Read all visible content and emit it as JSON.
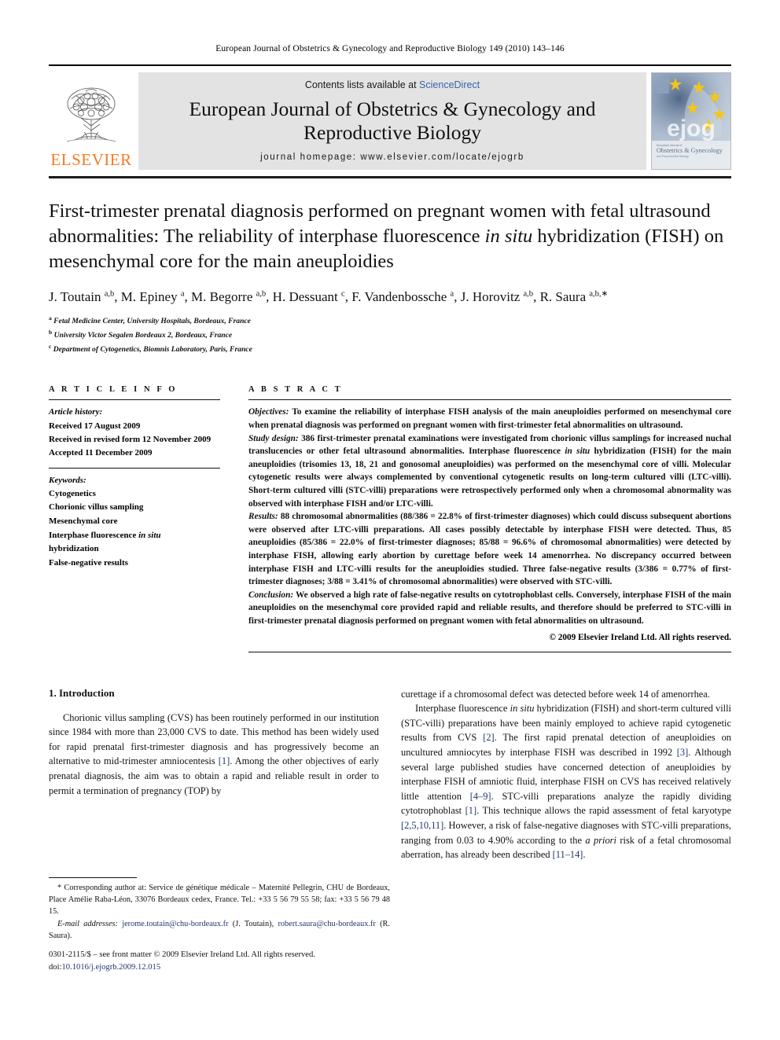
{
  "running_head": "European Journal of Obstetrics & Gynecology and Reproductive Biology 149 (2010) 143–146",
  "masthead": {
    "publisher": "ELSEVIER",
    "contents_prefix": "Contents lists available at ",
    "contents_link": "ScienceDirect",
    "journal_title_line1": "European Journal of Obstetrics & Gynecology and",
    "journal_title_line2": "Reproductive Biology",
    "homepage": "journal homepage: www.elsevier.com/locate/ejogrb",
    "cover_wordmark": "ejog",
    "cover_sub1": "Obstetrics & Gynecology",
    "cover_sub2": "and Reproductive Biology",
    "cover_kicker": "European Journal of"
  },
  "article": {
    "title": "First-trimester prenatal diagnosis performed on pregnant women with fetal ultrasound abnormalities: The reliability of interphase fluorescence in situ hybridization (FISH) on mesenchymal core for the main aneuploidies",
    "authors_html": "J. Toutain <sup>a,b</sup>, M. Epiney <sup>a</sup>, M. Begorre <sup>a,b</sup>, H. Dessuant <sup>c</sup>, F. Vandenbossche <sup>a</sup>, J. Horovitz <sup>a,b</sup>, R. Saura <sup>a,b,∗</sup>",
    "affiliations": [
      "Fetal Medicine Center, University Hospitals, Bordeaux, France",
      "University Victor Segalen Bordeaux 2, Bordeaux, France",
      "Department of Cytogenetics, Biomnis Laboratory, Paris, France"
    ],
    "affiliation_marks": [
      "a",
      "b",
      "c"
    ]
  },
  "info": {
    "heading": "A R T I C L E   I N F O",
    "history_label": "Article history:",
    "history": [
      "Received 17 August 2009",
      "Received in revised form 12 November 2009",
      "Accepted 11 December 2009"
    ],
    "keywords_label": "Keywords:",
    "keywords": [
      "Cytogenetics",
      "Chorionic villus sampling",
      "Mesenchymal core",
      "Interphase fluorescence in situ",
      "hybridization",
      "False-negative results"
    ]
  },
  "abstract": {
    "heading": "A B S T R A C T",
    "objectives_label": "Objectives:",
    "objectives_text": " To examine the reliability of interphase FISH analysis of the main aneuploidies performed on mesenchymal core when prenatal diagnosis was performed on pregnant women with first-trimester fetal abnormalities on ultrasound.",
    "study_design_label": "Study design:",
    "study_design_text": " 386 first-trimester prenatal examinations were investigated from chorionic villus samplings for increased nuchal translucencies or other fetal ultrasound abnormalities. Interphase fluorescence in situ hybridization (FISH) for the main aneuploidies (trisomies 13, 18, 21 and gonosomal aneuploidies) was performed on the mesenchymal core of villi. Molecular cytogenetic results were always complemented by conventional cytogenetic results on long-term cultured villi (LTC-villi). Short-term cultured villi (STC-villi) preparations were retrospectively performed only when a chromosomal abnormality was observed with interphase FISH and/or LTC-villi.",
    "results_label": "Results:",
    "results_text": " 88 chromosomal abnormalities (88/386 = 22.8% of first-trimester diagnoses) which could discuss subsequent abortions were observed after LTC-villi preparations. All cases possibly detectable by interphase FISH were detected. Thus, 85 aneuploidies (85/386 = 22.0% of first-trimester diagnoses; 85/88 = 96.6% of chromosomal abnormalities) were detected by interphase FISH, allowing early abortion by curettage before week 14 amenorrhea. No discrepancy occurred between interphase FISH and LTC-villi results for the aneuploidies studied. Three false-negative results (3/386 = 0.77% of first-trimester diagnoses; 3/88 = 3.41% of chromosomal abnormalities) were observed with STC-villi.",
    "conclusion_label": "Conclusion:",
    "conclusion_text": " We observed a high rate of false-negative results on cytotrophoblast cells. Conversely, interphase FISH of the main aneuploidies on the mesenchymal core provided rapid and reliable results, and therefore should be preferred to STC-villi in first-trimester prenatal diagnosis performed on pregnant women with fetal abnormalities on ultrasound.",
    "copyright": "© 2009 Elsevier Ireland Ltd. All rights reserved."
  },
  "introduction": {
    "heading": "1. Introduction",
    "left_para_1": "Chorionic villus sampling (CVS) has been routinely performed in our institution since 1984 with more than 23,000 CVS to date. This method has been widely used for rapid prenatal first-trimester diagnosis and has progressively become an alternative to mid-trimester amniocentesis [1]. Among the other objectives of early prenatal diagnosis, the aim was to obtain a rapid and reliable result in order to permit a termination of pregnancy (TOP) by",
    "right_para_1_cont": "curettage if a chromosomal defect was detected before week 14 of amenorrhea.",
    "right_para_2": "Interphase fluorescence in situ hybridization (FISH) and short-term cultured villi (STC-villi) preparations have been mainly employed to achieve rapid cytogenetic results from CVS [2]. The first rapid prenatal detection of aneuploidies on uncultured amniocytes by interphase FISH was described in 1992 [3]. Although several large published studies have concerned detection of aneuploidies by interphase FISH of amniotic fluid, interphase FISH on CVS has received relatively little attention [4–9]. STC-villi preparations analyze the rapidly dividing cytotrophoblast [1]. This technique allows the rapid assessment of fetal karyotype [2,5,10,11]. However, a risk of false-negative diagnoses with STC-villi preparations, ranging from 0.03 to 4.90% according to the a priori risk of a fetal chromosomal aberration, has already been described [11–14]."
  },
  "footnotes": {
    "corresponding_marker": "*",
    "corresponding_text": "Corresponding author at: Service de génétique médicale – Maternité Pellegrin, CHU de Bordeaux, Place Amélie Raba-Léon, 33076 Bordeaux cedex, France. Tel.: +33 5 56 79 55 58; fax: +33 5 56 79 48 15.",
    "email_label": "E-mail addresses:",
    "email_1": "jerome.toutain@chu-bordeaux.fr",
    "email_1_owner": " (J. Toutain),",
    "email_2": "robert.saura@chu-bordeaux.fr",
    "email_2_owner": " (R. Saura)."
  },
  "issn": {
    "line1": "0301-2115/$ – see front matter © 2009 Elsevier Ireland Ltd. All rights reserved.",
    "doi_prefix": "doi:",
    "doi": "10.1016/j.ejogrb.2009.12.015"
  },
  "colors": {
    "elsevier_orange": "#F47B20",
    "link_blue": "#22356e",
    "sciencedirect_blue": "#3a63ad",
    "band_gray": "#e3e3e3"
  }
}
